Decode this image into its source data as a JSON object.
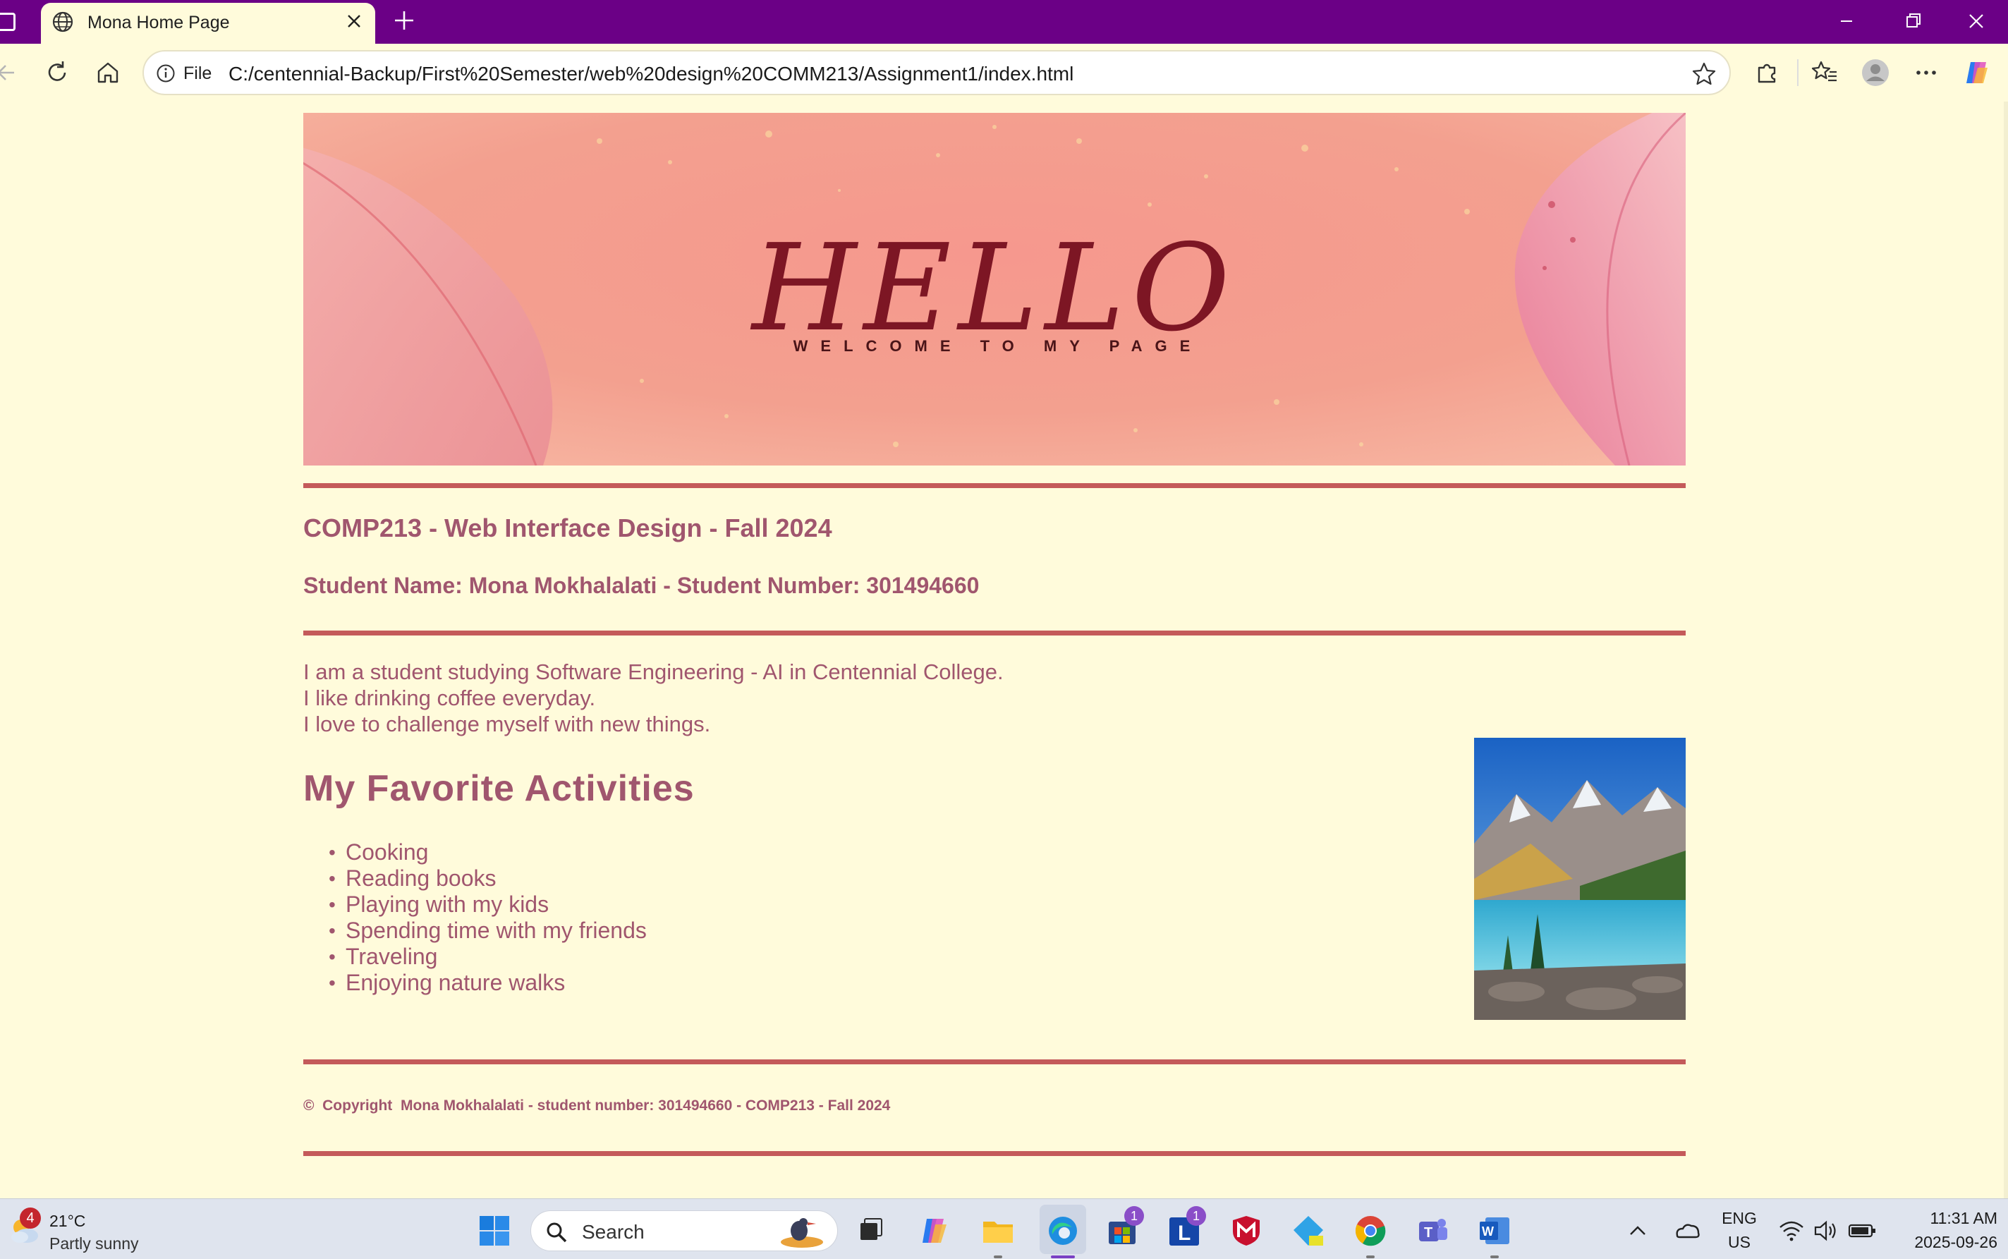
{
  "browser": {
    "tab_title": "Mona Home Page",
    "url_scheme_label": "File",
    "url": "C:/centennial-Backup/First%20Semester/web%20design%20COMM213/Assignment1/index.html"
  },
  "page": {
    "banner": {
      "title": "HELLO",
      "subtitle": "WELCOME TO MY PAGE"
    },
    "course": "COMP213 - Web Interface Design - Fall 2024",
    "student": "Student Name: Mona Mokhalalati - Student Number: 301494660",
    "bio": [
      "I am a student studying Software Engineering - AI in Centennial College.",
      "I like drinking coffee everyday.",
      "I love to challenge myself with new things."
    ],
    "activities_heading": "My Favorite Activities",
    "activities": [
      "Cooking",
      "Reading books",
      "Playing with my kids",
      "Spending time with my friends",
      "Traveling",
      "Enjoying nature walks"
    ],
    "copyright": "©  Copyright  Mona Mokhalalati - student number: 301494660 - COMP213 - Fall 2024"
  },
  "taskbar": {
    "weather": {
      "temp": "21°C",
      "condition": "Partly sunny",
      "badge": "4"
    },
    "search_placeholder": "Search",
    "store_badge": "1",
    "linkedin_badge": "1",
    "language": "ENG",
    "region": "US",
    "time": "11:31 AM",
    "date": "2025-09-26"
  },
  "colors": {
    "page_background": "#fffbdb",
    "text": "#a0566e",
    "rule": "#c45a5a",
    "titlebar": "#6b0086"
  }
}
